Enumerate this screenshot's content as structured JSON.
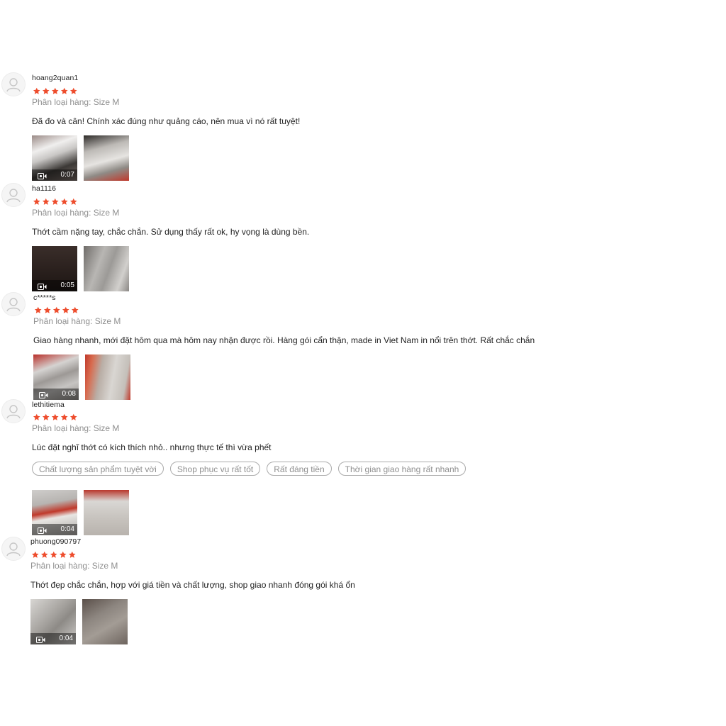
{
  "colors": {
    "star": "#ee4d2d",
    "muted": "#8f8f8f",
    "text": "#222222"
  },
  "icons": {
    "avatar": "user-silhouette-icon",
    "star": "star-icon",
    "video": "video-camera-icon"
  },
  "reviews": [
    {
      "username": "hoang2quan1",
      "rating": 5,
      "variation": "Phân loại hàng: Size M",
      "comment": "Đã đo và cân! Chính xác đúng như quảng cáo, nên mua vì nó rất tuyệt!",
      "tags": [],
      "media": [
        {
          "type": "video",
          "duration": "0:07"
        },
        {
          "type": "image"
        }
      ]
    },
    {
      "username": "ha1116",
      "rating": 5,
      "variation": "Phân loại hàng: Size M",
      "comment": "Thớt cầm nặng tay, chắc chắn. Sử dụng thấy rất ok, hy vọng là dùng bền.",
      "tags": [],
      "media": [
        {
          "type": "video",
          "duration": "0:05"
        },
        {
          "type": "image"
        }
      ]
    },
    {
      "username": "c*****s",
      "rating": 5,
      "variation": "Phân loại hàng: Size M",
      "comment": "Giao hàng nhanh, mới đặt hôm qua mà hôm nay nhận được rồi. Hàng gói cẩn thận, made in Viet Nam in nổi trên thớt. Rất chắc chắn",
      "tags": [],
      "media": [
        {
          "type": "video",
          "duration": "0:08"
        },
        {
          "type": "image"
        }
      ]
    },
    {
      "username": "lethitiema",
      "rating": 5,
      "variation": "Phân loại hàng: Size M",
      "comment": "Lúc đặt nghĩ thớt có kích thích nhỏ.. nhưng thực tế thì vừa phết",
      "tags": [
        "Chất lượng sản phẩm tuyệt vời",
        "Shop phục vụ rất tốt",
        "Rất đáng tiền",
        "Thời gian giao hàng rất nhanh"
      ],
      "media": [
        {
          "type": "video",
          "duration": "0:04"
        },
        {
          "type": "image"
        }
      ]
    },
    {
      "username": "phuong090797",
      "rating": 5,
      "variation": "Phân loại hàng: Size M",
      "comment": "Thớt đẹp chắc chắn, hợp với giá tiền và chất lượng, shop giao nhanh đóng gói khá ổn",
      "tags": [],
      "media": [
        {
          "type": "video",
          "duration": "0:04"
        },
        {
          "type": "image"
        }
      ]
    }
  ]
}
